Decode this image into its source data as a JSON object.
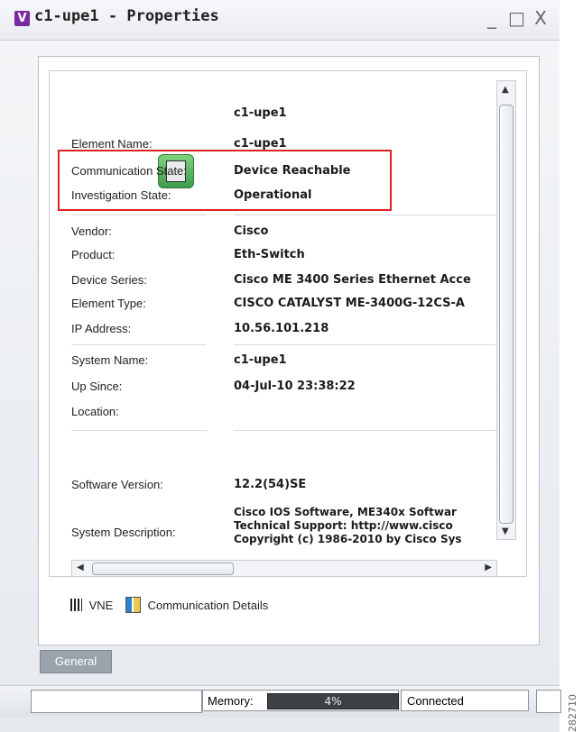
{
  "window": {
    "title_icon": "V",
    "title": "c1-upe1 - Properties",
    "controls": [
      "_",
      "□",
      "X"
    ]
  },
  "properties": {
    "header_value": "c1-upe1",
    "element_name_label": "Element Name:",
    "element_name": "c1-upe1",
    "communication_state_label": "Communication State:",
    "communication_state": "Device Reachable",
    "investigation_state_label": "Investigation State:",
    "investigation_state": "Operational",
    "vendor_label": "Vendor:",
    "vendor": "Cisco",
    "product_label": "Product:",
    "product": "Eth-Switch",
    "device_series_label": "Device Series:",
    "device_series": "Cisco ME 3400 Series Ethernet Acce",
    "element_type_label": "Element Type:",
    "element_type": "CISCO CATALYST ME-3400G-12CS-A",
    "ip_address_label": "IP Address:",
    "ip_address": "10.56.101.218",
    "system_name_label": "System Name:",
    "system_name": "c1-upe1",
    "up_since_label": "Up Since:",
    "up_since": "04-Jul-10 23:38:22",
    "location_label": "Location:",
    "location": "",
    "software_version_label": "Software Version:",
    "software_version": "12.2(54)SE",
    "system_description_label": "System Description:",
    "system_description_lines": [
      "Cisco IOS Software, ME340x Softwar",
      "Technical Support: http://www.cisco",
      "Copyright (c) 1986-2010 by Cisco Sys"
    ]
  },
  "actions": {
    "vne_label": "VNE",
    "communication_details_label": "Communication Details"
  },
  "tabs": {
    "general_label": "General"
  },
  "status_bar": {
    "memory_label": "Memory:",
    "memory_percent": "4%",
    "connection_status": "Connected"
  },
  "side_text": "282710",
  "colors": {
    "highlight_box": "#dd2222",
    "window_bg": "#f4f6f8",
    "device_icon": "#3e9b4a",
    "memory_bar": "#3d4146"
  }
}
